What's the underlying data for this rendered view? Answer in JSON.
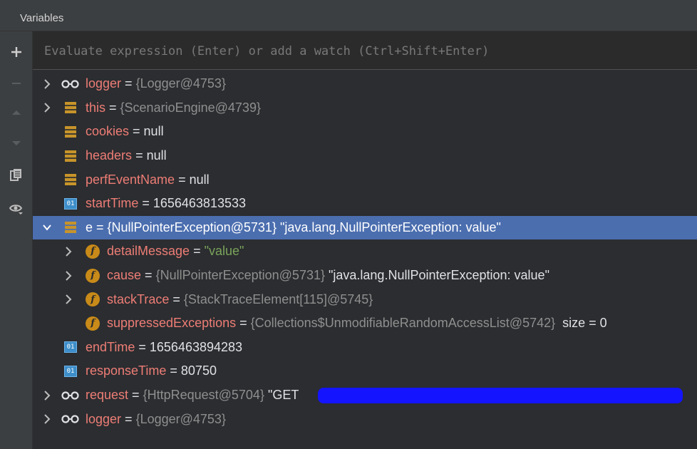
{
  "panel": {
    "title": "Variables"
  },
  "colors": {
    "background": "#2b2d30",
    "selection": "#4b6eaf",
    "name": "#ee7d76",
    "string": "#7aa35a",
    "type": "#8f8f8f"
  },
  "evaluate": {
    "placeholder": "Evaluate expression (Enter) or add a watch (Ctrl+Shift+Enter)"
  },
  "toolbar": {
    "icons": [
      "plus-icon",
      "minus-icon",
      "arrow-up-icon",
      "arrow-down-icon",
      "copy-icon",
      "watch-eye-icon"
    ]
  },
  "rows": [
    {
      "name": "logger",
      "eq": " = ",
      "type": "{Logger@4753}",
      "value": "",
      "icon": "watch-glasses-icon",
      "expandable": true,
      "expanded": false
    },
    {
      "name": "this",
      "eq": " = ",
      "type": "{ScenarioEngine@4739}",
      "value": "",
      "icon": "object-stack-icon",
      "expandable": true,
      "expanded": false
    },
    {
      "name": "cookies",
      "eq": " = ",
      "type": "",
      "value": "null",
      "icon": "object-stack-icon",
      "expandable": false
    },
    {
      "name": "headers",
      "eq": " = ",
      "type": "",
      "value": "null",
      "icon": "object-stack-icon",
      "expandable": false
    },
    {
      "name": "perfEventName",
      "eq": " = ",
      "type": "",
      "value": "null",
      "icon": "object-stack-icon",
      "expandable": false
    },
    {
      "name": "startTime",
      "eq": " = ",
      "type": "",
      "value": "1656463813533",
      "icon": "primitive-icon",
      "expandable": false
    },
    {
      "name": "e",
      "eq": " = ",
      "type": "{NullPointerException@5731}",
      "value": " \"java.lang.NullPointerException: value\"",
      "icon": "object-stack-icon",
      "expandable": true,
      "expanded": true,
      "selected": true
    },
    {
      "name": "detailMessage",
      "eq": " = ",
      "type": "",
      "value": "\"value\"",
      "icon": "field-icon",
      "expandable": true,
      "expanded": false,
      "string": true
    },
    {
      "name": "cause",
      "eq": " = ",
      "type": "{NullPointerException@5731}",
      "value": " \"java.lang.NullPointerException: value\"",
      "icon": "field-icon",
      "expandable": true,
      "expanded": false
    },
    {
      "name": "stackTrace",
      "eq": " = ",
      "type": "{StackTraceElement[115]@5745}",
      "value": "",
      "icon": "field-icon",
      "expandable": true,
      "expanded": false
    },
    {
      "name": "suppressedExceptions",
      "eq": " = ",
      "type": "{Collections$UnmodifiableRandomAccessList@5742}",
      "value": "  size = 0",
      "icon": "field-icon",
      "expandable": false
    },
    {
      "name": "endTime",
      "eq": " = ",
      "type": "",
      "value": "1656463894283",
      "icon": "primitive-icon",
      "expandable": false
    },
    {
      "name": "responseTime",
      "eq": " = ",
      "type": "",
      "value": "80750",
      "icon": "primitive-icon",
      "expandable": false
    },
    {
      "name": "request",
      "eq": " = ",
      "type": "{HttpRequest@5704}",
      "value": " \"GET",
      "icon": "watch-glasses-icon",
      "expandable": true,
      "expanded": false
    },
    {
      "name": "logger",
      "eq": " = ",
      "type": "{Logger@4753}",
      "value": "",
      "icon": "watch-glasses-icon",
      "expandable": true,
      "expanded": false
    }
  ]
}
